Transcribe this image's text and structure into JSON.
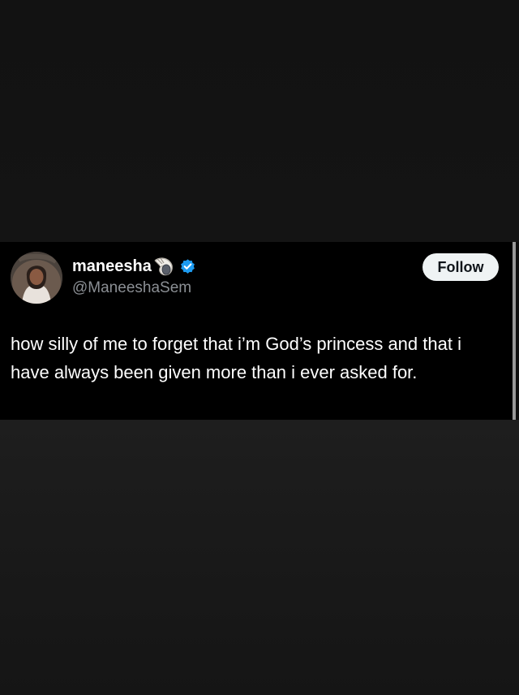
{
  "tweet": {
    "display_name": "maneesha",
    "handle": "@ManeeshaSem",
    "follow_label": "Follow",
    "text": "how silly of me to forget that i’m God’s princess and that i have always been given more than i ever asked for."
  },
  "icons": {
    "name_emoji": "spiral-shell-icon",
    "verified": "verified-badge-icon"
  },
  "colors": {
    "card_background": "#000000",
    "page_background": "#121212",
    "verified_blue": "#1d9bf0",
    "handle_gray": "#8b8f94",
    "follow_button_bg": "#eff3f4"
  }
}
